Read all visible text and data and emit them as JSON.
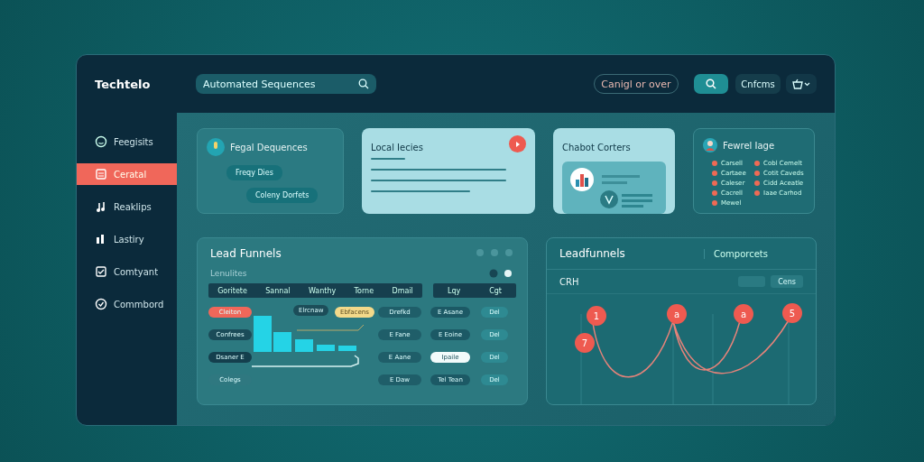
{
  "brand": {
    "name": "Techtelo"
  },
  "search": {
    "value": "Automated Sequences"
  },
  "header": {
    "filter": "Canigl or over",
    "button": "Cnfcms"
  },
  "sidebar": {
    "items": [
      {
        "label": "Feegisits",
        "selected": false
      },
      {
        "label": "Ceratal",
        "selected": true
      },
      {
        "label": "Reaklips",
        "selected": false
      },
      {
        "label": "Lastiry",
        "selected": false
      },
      {
        "label": "Comtyant",
        "selected": false
      },
      {
        "label": "Commbord",
        "selected": false
      }
    ]
  },
  "cards": [
    {
      "kind": "chat",
      "title": "Fegal Dequences",
      "bubbles": [
        "Freqy Dies",
        "Coleny Dorfets"
      ]
    },
    {
      "kind": "lines",
      "title": "Local Iecies"
    },
    {
      "kind": "widget",
      "title": "Chabot Corters"
    },
    {
      "kind": "list",
      "title": "Fewrel Iage",
      "items": [
        "Carsell",
        "Cobl Cemelt",
        "Cartaee",
        "Cotit Caveds",
        "Caleser",
        "Cidd Aceatle",
        "Cacrell",
        "Iaae Carhod",
        "Mewel"
      ]
    }
  ],
  "funnel_panel": {
    "title": "Lead Funnels",
    "subtitle": "Lenulites",
    "columns": [
      "Goritete",
      "Sannal",
      "Wanthy",
      "Torne",
      "Dmail"
    ],
    "side_columns": [
      "Lqy",
      "Cgt"
    ],
    "tags": [
      {
        "label": "Cleiton",
        "color": "#f0675a"
      },
      {
        "label": "Confrees",
        "color": "#1b4b58"
      },
      {
        "label": "Dsaner E",
        "color": "#143f4d"
      },
      {
        "label": "Colegs",
        "color": "#2f7880"
      }
    ],
    "bar_labels": [
      "Elrcnaw",
      "Ebfacens"
    ],
    "col_a": [
      "Drefkd",
      "E Fane",
      "E Aane",
      "E Daw"
    ],
    "col_b": [
      {
        "label": "E Asane",
        "selected": false
      },
      {
        "label": "E Eoine",
        "selected": false
      },
      {
        "label": "Ipaile",
        "selected": true
      },
      {
        "label": "Tel Tean",
        "selected": false
      }
    ],
    "col_c": [
      "Del",
      "Del",
      "Del",
      "Del"
    ]
  },
  "chart_panel": {
    "title": "Leadfunnels",
    "tab": "Comporcets",
    "subtitle": "CRH",
    "button": "Cens",
    "markers": [
      "1",
      "7",
      "a",
      "a",
      "5"
    ]
  }
}
